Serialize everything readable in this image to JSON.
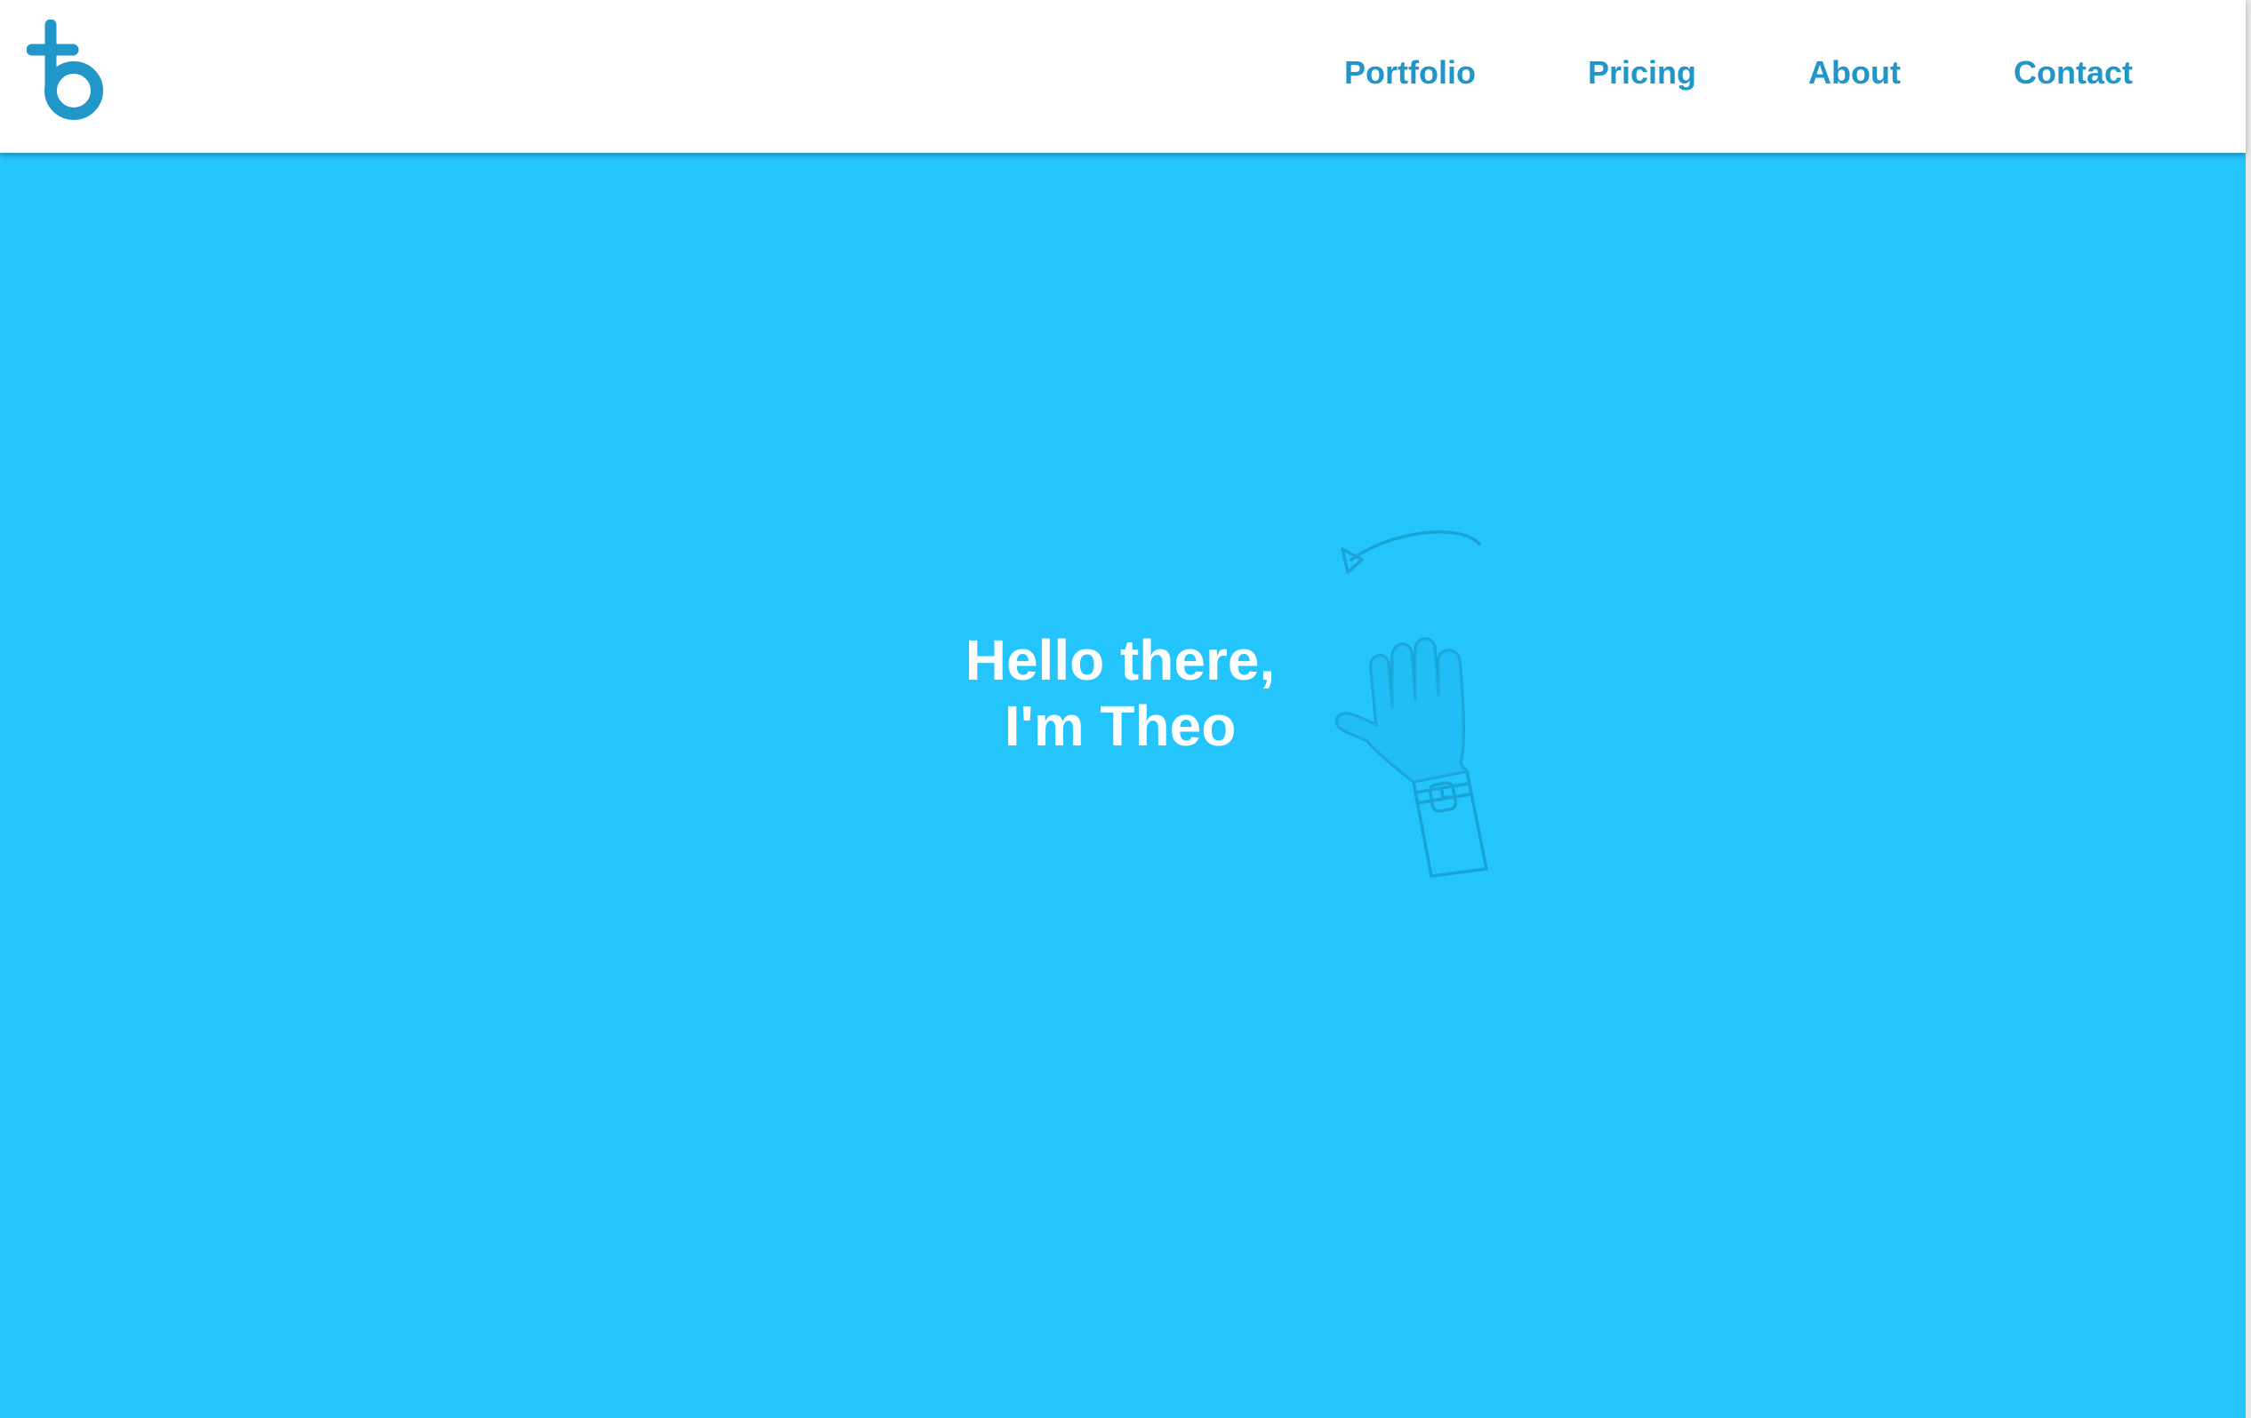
{
  "header": {
    "logo_icon": "tb-logo-icon",
    "nav": [
      {
        "label": "Portfolio"
      },
      {
        "label": "Pricing"
      },
      {
        "label": "About"
      },
      {
        "label": "Contact"
      }
    ]
  },
  "hero": {
    "heading_line1": "Hello there,",
    "heading_line2": "I'm Theo",
    "illustration_icon": "waving-hand-icon"
  },
  "colors": {
    "accent": "#2196c9",
    "hero_background": "#24c5fc",
    "header_background": "#ffffff",
    "heading_text": "#ffffff",
    "illustration_stroke": "#1aa3d6"
  }
}
